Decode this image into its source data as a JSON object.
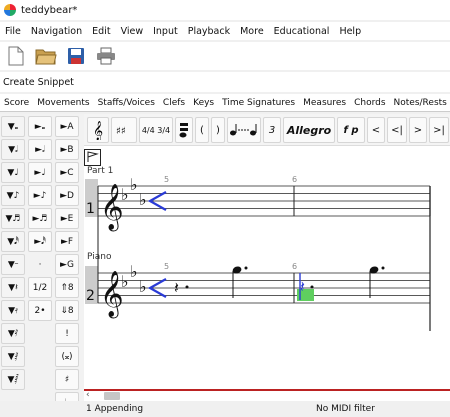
{
  "window": {
    "title": "teddybear*"
  },
  "menu": [
    "File",
    "Navigation",
    "Edit",
    "View",
    "Input",
    "Playback",
    "More",
    "Educational",
    "Help"
  ],
  "toolbar": {
    "icons": [
      "new-document-icon",
      "open-folder-icon",
      "save-icon",
      "print-icon"
    ]
  },
  "snippet": {
    "label": "Create Snippet"
  },
  "tabs": [
    "Score",
    "Movements",
    "Staffs/Voices",
    "Clefs",
    "Keys",
    "Time Signatures",
    "Measures",
    "Chords",
    "Notes/Rests"
  ],
  "palette": {
    "col1": [
      "▼𝅝",
      "▼𝅗𝅥",
      "▼♩",
      "▼♪",
      "▼♬",
      "▼𝅘𝅥𝅰",
      "▼𝄼",
      "▼𝄽",
      "▼𝄿",
      "▼𝅀",
      "▼𝅁",
      "▼𝅂"
    ],
    "col2": [
      "►𝅝",
      "►𝅗𝅥",
      "►♩",
      "►♪",
      "►♬",
      "►𝅘𝅥𝅰",
      "·",
      "1/2",
      "2•"
    ],
    "col3": [
      "►A",
      "►B",
      "►C",
      "►D",
      "►E",
      "►F",
      "►G",
      "⇑8",
      "⇓8",
      "!",
      "(𝄪)",
      "♯",
      "♭"
    ]
  },
  "ribbon": {
    "time_sig": "4/4 3/4",
    "paren_open": "(",
    "paren_close": ")",
    "triplet": "3",
    "tempo": "Allegro",
    "dynamics": "f p",
    "nav": [
      "<",
      "<|",
      ">",
      ">|"
    ]
  },
  "score": {
    "staff1": {
      "name": "Part 1",
      "number": "1"
    },
    "staff2": {
      "name": "Piano",
      "number": "2"
    },
    "measures": [
      "5",
      "6"
    ]
  },
  "status": {
    "mode": "1 Appending",
    "midi": "No MIDI filter"
  }
}
